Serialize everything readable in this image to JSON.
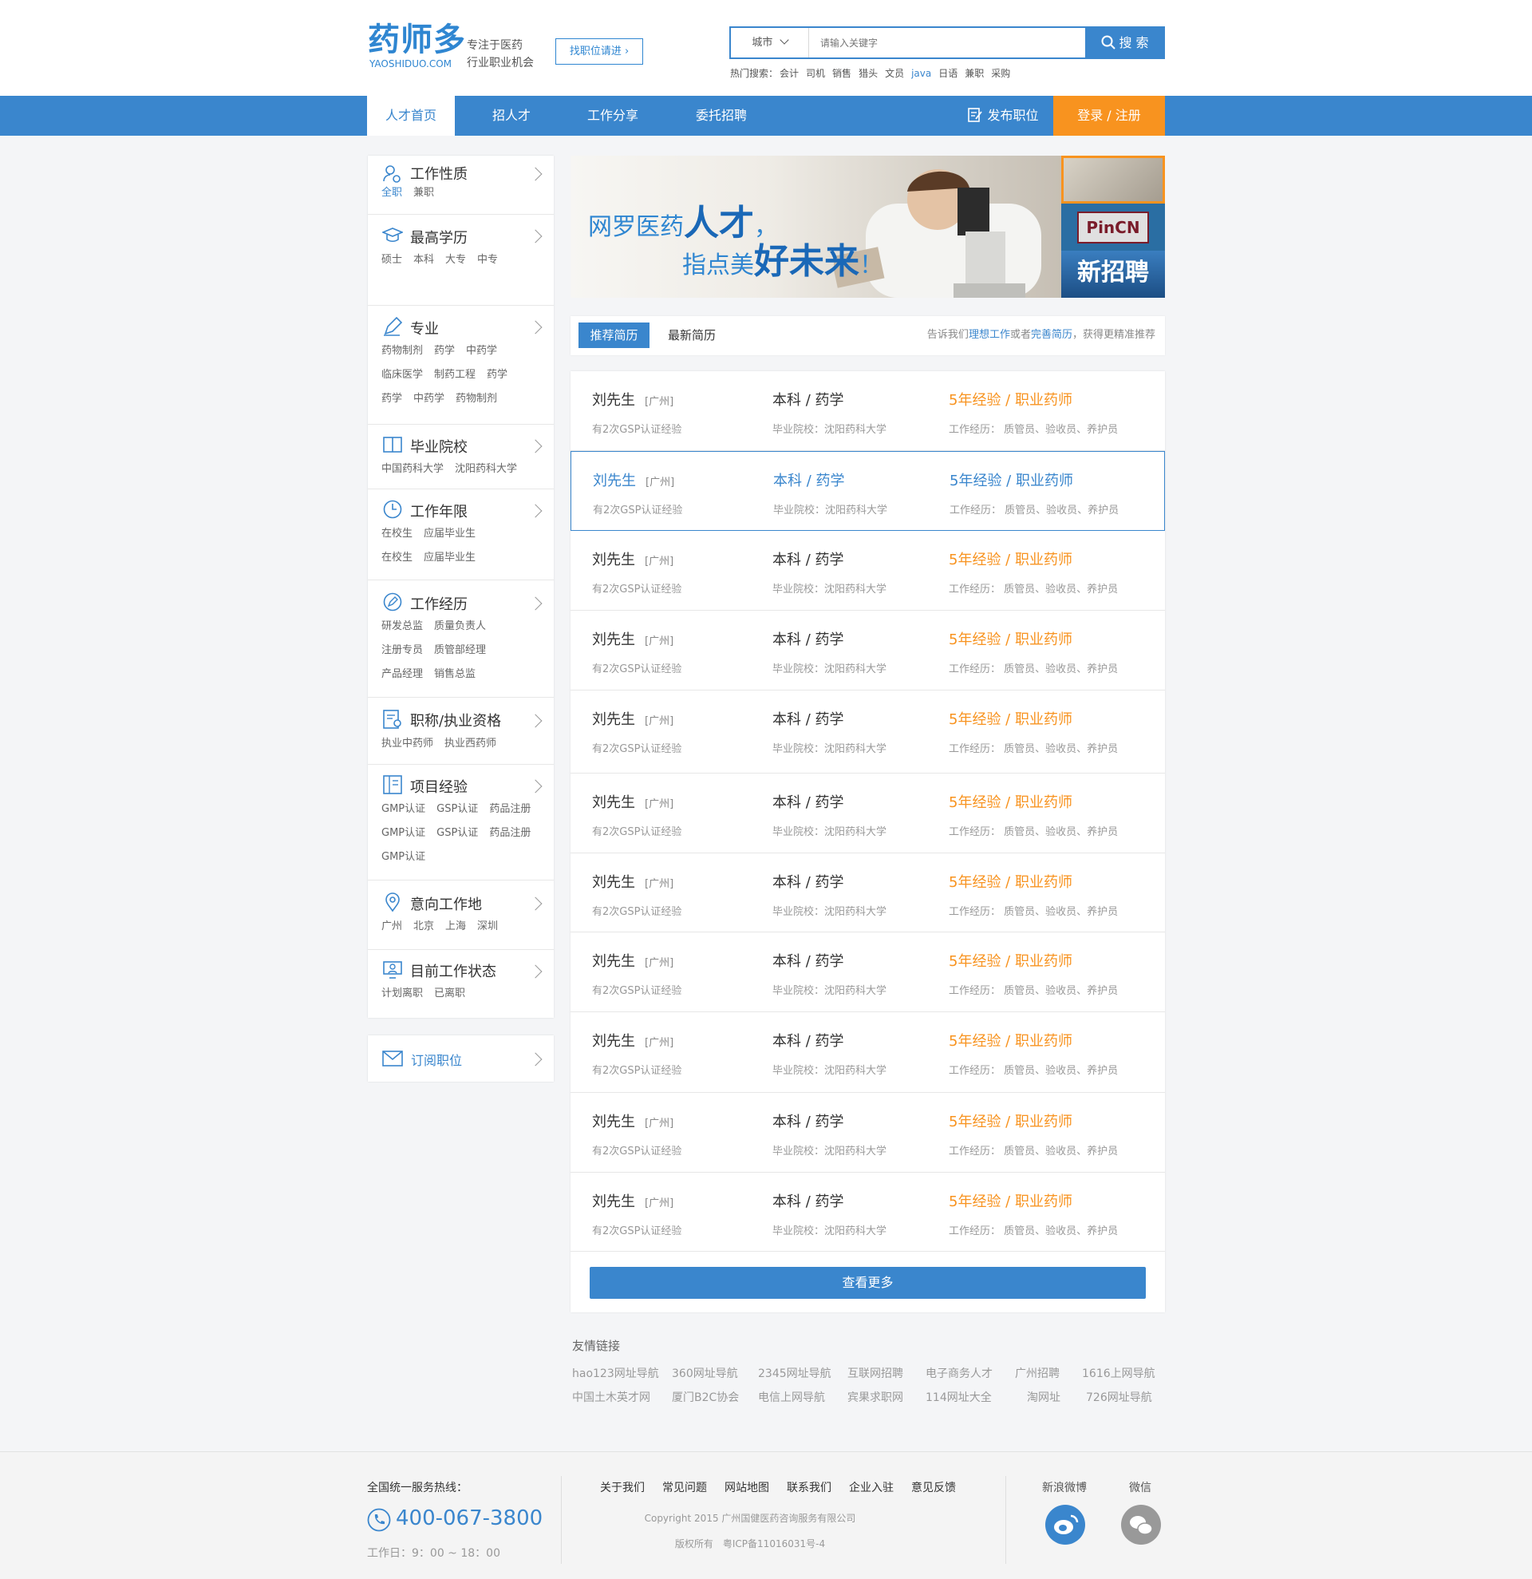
{
  "header": {
    "logo_cn": "药师多",
    "logo_en": "YAOSHIDUO.COM",
    "slogan_line1": "专注于医药",
    "slogan_line2": "行业职业机会",
    "find_job": "找职位请进 ›",
    "search": {
      "city": "城市",
      "placeholder": "请输入关键字",
      "button": "搜 索"
    },
    "hot_label": "热门搜索：",
    "hot": [
      "会计",
      "司机",
      "销售",
      "猎头",
      "文员",
      "java",
      "日语",
      "兼职",
      "采购"
    ]
  },
  "nav": {
    "items": [
      "人才首页",
      "招人才",
      "工作分享",
      "委托招聘"
    ],
    "post": "发布职位",
    "login": "登录 / 注册"
  },
  "sidebar": {
    "sections": [
      {
        "title": "工作性质",
        "icon": "user-gear-icon",
        "options": [
          "全职",
          "兼职"
        ],
        "selected": "全职"
      },
      {
        "title": "最高学历",
        "icon": "graduation-cap-icon",
        "options": [
          "硕士",
          "本科",
          "大专",
          "中专"
        ]
      },
      {
        "title": "专业",
        "icon": "pen-icon",
        "options": [
          "药物制剂",
          "药学",
          "中药学",
          "临床医学",
          "制药工程",
          "药学",
          "药学",
          "中药学",
          "药物制剂"
        ]
      },
      {
        "title": "毕业院校",
        "icon": "book-icon",
        "options": [
          "中国药科大学",
          "沈阳药科大学"
        ]
      },
      {
        "title": "工作年限",
        "icon": "clock-icon",
        "options": [
          "在校生",
          "应届毕业生",
          "在校生",
          "应届毕业生"
        ]
      },
      {
        "title": "工作经历",
        "icon": "edit-circle-icon",
        "options": [
          "研发总监",
          "质量负责人",
          "注册专员",
          "质管部经理",
          "产品经理",
          "销售总监"
        ]
      },
      {
        "title": "职称/执业资格",
        "icon": "certificate-icon",
        "options": [
          "执业中药师",
          "执业西药师"
        ]
      },
      {
        "title": "项目经验",
        "icon": "document-icon",
        "options": [
          "GMP认证",
          "GSP认证",
          "药品注册",
          "GMP认证",
          "GSP认证",
          "药品注册",
          "GMP认证"
        ]
      },
      {
        "title": "意向工作地",
        "icon": "location-pin-icon",
        "options": [
          "广州",
          "北京",
          "上海",
          "深圳"
        ]
      },
      {
        "title": "目前工作状态",
        "icon": "monitor-user-icon",
        "options": [
          "计划离职",
          "已离职"
        ]
      }
    ],
    "subscribe": "订阅职位"
  },
  "banner": {
    "line1a": "网罗医药",
    "line1b": "人才",
    "line1c": "，",
    "line2a": "指点美",
    "line2b": "好未来",
    "line2c": "！",
    "thumb2": "PinCN",
    "thumb3": "新招聘"
  },
  "tabs": {
    "recommended": "推荐简历",
    "latest": "最新简历",
    "tip_pre": "告诉我们",
    "tip_link1": "理想工作",
    "tip_mid": "或者",
    "tip_link2": "完善简历",
    "tip_post": "，获得更精准推荐"
  },
  "resumes": [
    {
      "name": "刘先生",
      "city": "[广州]",
      "exp": "有2次GSP认证经验",
      "edu": "本科 / 药学",
      "school": "毕业院校：沈阳药科大学",
      "years": "5年经验 / 职业药师",
      "work": "工作经历： 质管员、验收员、养护员"
    },
    {
      "name": "刘先生",
      "city": "[广州]",
      "exp": "有2次GSP认证经验",
      "edu": "本科 / 药学",
      "school": "毕业院校：沈阳药科大学",
      "years": "5年经验 / 职业药师",
      "work": "工作经历： 质管员、验收员、养护员"
    },
    {
      "name": "刘先生",
      "city": "[广州]",
      "exp": "有2次GSP认证经验",
      "edu": "本科 / 药学",
      "school": "毕业院校：沈阳药科大学",
      "years": "5年经验 / 职业药师",
      "work": "工作经历： 质管员、验收员、养护员"
    },
    {
      "name": "刘先生",
      "city": "[广州]",
      "exp": "有2次GSP认证经验",
      "edu": "本科 / 药学",
      "school": "毕业院校：沈阳药科大学",
      "years": "5年经验 / 职业药师",
      "work": "工作经历： 质管员、验收员、养护员"
    },
    {
      "name": "刘先生",
      "city": "[广州]",
      "exp": "有2次GSP认证经验",
      "edu": "本科 / 药学",
      "school": "毕业院校：沈阳药科大学",
      "years": "5年经验 / 职业药师",
      "work": "工作经历： 质管员、验收员、养护员"
    },
    {
      "name": "刘先生",
      "city": "[广州]",
      "exp": "有2次GSP认证经验",
      "edu": "本科 / 药学",
      "school": "毕业院校：沈阳药科大学",
      "years": "5年经验 / 职业药师",
      "work": "工作经历： 质管员、验收员、养护员"
    },
    {
      "name": "刘先生",
      "city": "[广州]",
      "exp": "有2次GSP认证经验",
      "edu": "本科 / 药学",
      "school": "毕业院校：沈阳药科大学",
      "years": "5年经验 / 职业药师",
      "work": "工作经历： 质管员、验收员、养护员"
    },
    {
      "name": "刘先生",
      "city": "[广州]",
      "exp": "有2次GSP认证经验",
      "edu": "本科 / 药学",
      "school": "毕业院校：沈阳药科大学",
      "years": "5年经验 / 职业药师",
      "work": "工作经历： 质管员、验收员、养护员"
    },
    {
      "name": "刘先生",
      "city": "[广州]",
      "exp": "有2次GSP认证经验",
      "edu": "本科 / 药学",
      "school": "毕业院校：沈阳药科大学",
      "years": "5年经验 / 职业药师",
      "work": "工作经历： 质管员、验收员、养护员"
    },
    {
      "name": "刘先生",
      "city": "[广州]",
      "exp": "有2次GSP认证经验",
      "edu": "本科 / 药学",
      "school": "毕业院校：沈阳药科大学",
      "years": "5年经验 / 职业药师",
      "work": "工作经历： 质管员、验收员、养护员"
    },
    {
      "name": "刘先生",
      "city": "[广州]",
      "exp": "有2次GSP认证经验",
      "edu": "本科 / 药学",
      "school": "毕业院校：沈阳药科大学",
      "years": "5年经验 / 职业药师",
      "work": "工作经历： 质管员、验收员、养护员"
    }
  ],
  "more_button": "查看更多",
  "friend_links": {
    "title": "友情链接",
    "row1": [
      "hao123网址导航",
      "360网址导航",
      "2345网址导航",
      "互联网招聘",
      "电子商务人才",
      "广州招聘",
      "1616上网导航"
    ],
    "row2": [
      "中国土木英才网",
      "厦门B2C协会",
      "电信上网导航",
      "宾果求职网",
      "114网址大全",
      "淘网址",
      "726网址导航"
    ]
  },
  "footer": {
    "hotline_label": "全国统一服务热线：",
    "phone": "400-067-3800",
    "hours": "工作日：9：00 ~ 18：00",
    "links": [
      "关于我们",
      "常见问题",
      "网站地图",
      "联系我们",
      "企业入驻",
      "意见反馈"
    ],
    "copyright": "Copyright 2015 广州国健医药咨询服务有限公司",
    "icp": "版权所有　粤ICP备11016031号-4",
    "weibo": "新浪微博",
    "wechat": "微信"
  },
  "colors": {
    "primary": "#3a86cd",
    "accent": "#f8931f"
  }
}
